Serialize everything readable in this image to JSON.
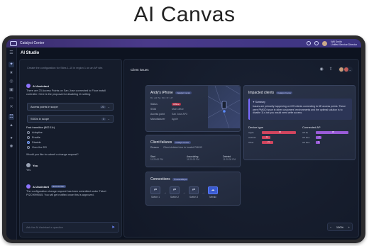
{
  "headline": "AI Canvas",
  "topbar": {
    "app_title": "Catalyst Center",
    "user_name": "Will Smith",
    "user_org": "Unified Service Director"
  },
  "studio": {
    "title": "AI Studio"
  },
  "left_panel": {
    "intro": "Create the configuration for Sites 1-10 in region 1 on an AP site.",
    "assistant_name": "AI Assistant",
    "assistant_msg": "There are 23 Access Points on San Jose connected to Floor install controller. Here is the proposal for disabling 11 setting.",
    "select1_label": "Access points in scope",
    "select1_count": "23",
    "select2_label": "SSIDs in scope",
    "select2_count": "3",
    "fast_transition_label": "Fast transition (802.11r)",
    "options": [
      "Adaptive",
      "Enable",
      "Disable",
      "Over the DS"
    ],
    "question": "Would you like to submit a change request?",
    "you_label": "You",
    "you_msg": "Yes",
    "assistant2_badge": "Remote files",
    "assistant2_msg": "The configuration change request has been submitted under Ticket PI2C9999045. You will get notified once this is approved.",
    "ask_placeholder": "Ask the AI Assistant a question"
  },
  "canvas": {
    "title": "Client issues",
    "zoom_level": "100%",
    "device_card": {
      "title": "Andy's iPhone",
      "tag": "Catalyst Center",
      "sub": "Bc: a4f: 5e: 5d1: 6f: 147",
      "rows": [
        {
          "k": "Status",
          "v": "Offline"
        },
        {
          "k": "SSID",
          "v": "Main office"
        },
        {
          "k": "Access point",
          "v": "San Jose AP3"
        },
        {
          "k": "Manufacturer",
          "v": "Apple"
        }
      ]
    },
    "failures_card": {
      "title": "Client failures",
      "tag": "Catalyst Center",
      "reason_k": "Reason",
      "reason_v": "Client deleted due to invalid PMKID",
      "events": [
        {
          "label": "Start",
          "time": "11:20:00 PM"
        },
        {
          "label": "Associating",
          "time": "11:20:00 PM"
        },
        {
          "label": "Deleted",
          "time": "11:20:00 PM"
        }
      ]
    },
    "connections_card": {
      "title": "Connections",
      "tag": "ThousandEyes",
      "nodes": [
        "Switch 1",
        "Switch 2",
        "Switch 3",
        "Meraki"
      ]
    },
    "impacted_card": {
      "title": "Impacted clients",
      "tag": "Catalyst Center",
      "summary_label": "Summary",
      "summary_text": "Issues are primarily happening on iOS clients connecting to 6E access points. These were PMKID issue in other customers' environments and the optimal solution is to disable 11r, but you would need write access.",
      "device_type_header": "Device type",
      "ap_header": "Connected AP",
      "device_types": [
        {
          "label": "Apple",
          "value": "95"
        },
        {
          "label": "Android",
          "value": "12"
        },
        {
          "label": "Other",
          "value": "21"
        }
      ],
      "aps": [
        {
          "label": "AP 6e",
          "value": "95"
        },
        {
          "label": "AP Flex",
          "value": "2"
        },
        {
          "label": "AP Flex",
          "value": "1"
        }
      ]
    }
  }
}
